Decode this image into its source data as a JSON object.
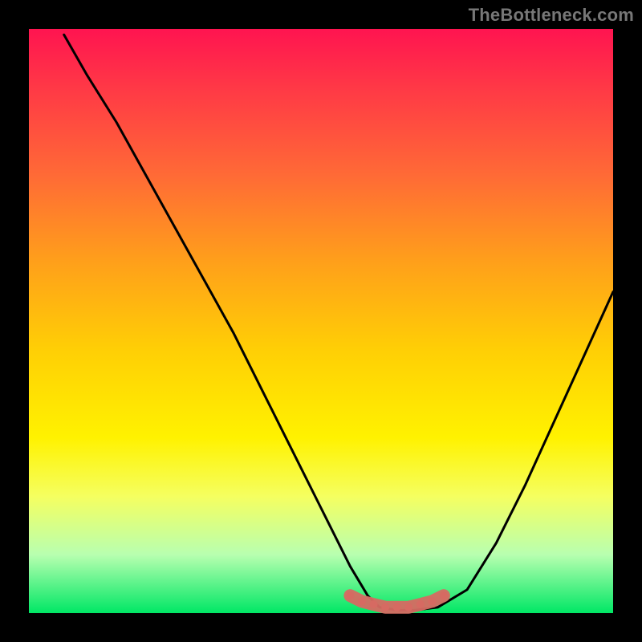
{
  "watermark": "TheBottleneck.com",
  "chart_data": {
    "type": "line",
    "title": "",
    "xlabel": "",
    "ylabel": "",
    "xlim": [
      0,
      100
    ],
    "ylim": [
      0,
      100
    ],
    "series": [
      {
        "name": "curve",
        "x": [
          6,
          10,
          15,
          20,
          25,
          30,
          35,
          40,
          45,
          50,
          55,
          58,
          60,
          63,
          66,
          70,
          75,
          80,
          85,
          90,
          95,
          100
        ],
        "values": [
          99,
          92,
          84,
          75,
          66,
          57,
          48,
          38,
          28,
          18,
          8,
          3,
          1,
          0.5,
          0.5,
          1,
          4,
          12,
          22,
          33,
          44,
          55
        ]
      },
      {
        "name": "highlight-band",
        "x": [
          55,
          57,
          59,
          61,
          63,
          65,
          67,
          69,
          71
        ],
        "values": [
          3,
          2,
          1.5,
          1,
          1,
          1,
          1.5,
          2,
          3
        ]
      }
    ],
    "background_gradient": {
      "top": "#ff1450",
      "mid": "#fff200",
      "bottom": "#00e765"
    }
  }
}
